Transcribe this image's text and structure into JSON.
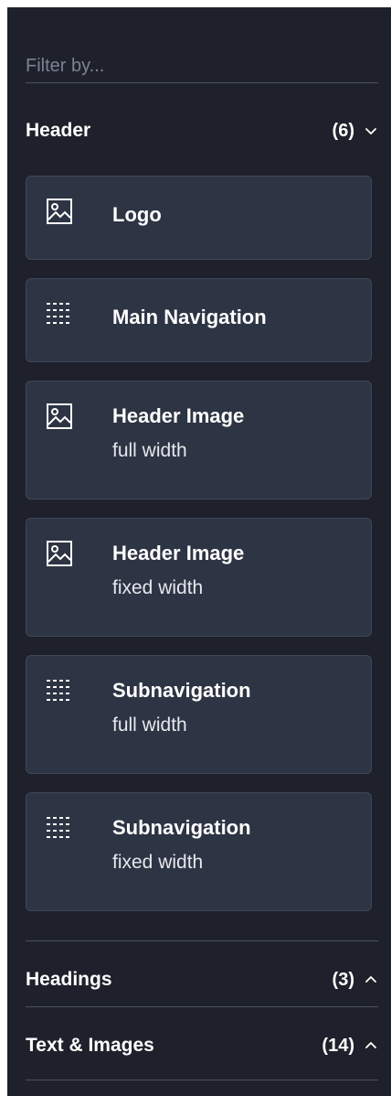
{
  "filter": {
    "placeholder": "Filter by..."
  },
  "sections": [
    {
      "title": "Header",
      "count": "(6)",
      "expanded": true,
      "items": [
        {
          "icon": "image-icon",
          "title": "Logo",
          "subtitle": ""
        },
        {
          "icon": "grid-dots-icon",
          "title": "Main Navigation",
          "subtitle": ""
        },
        {
          "icon": "image-icon",
          "title": "Header Image",
          "subtitle": "full width"
        },
        {
          "icon": "image-icon",
          "title": "Header Image",
          "subtitle": "fixed width"
        },
        {
          "icon": "grid-dots-icon",
          "title": "Subnavigation",
          "subtitle": "full width"
        },
        {
          "icon": "grid-dots-icon",
          "title": "Subnavigation",
          "subtitle": "fixed width"
        }
      ]
    },
    {
      "title": "Headings",
      "count": "(3)",
      "expanded": false
    },
    {
      "title": "Text & Images",
      "count": "(14)",
      "expanded": false
    }
  ],
  "colors": {
    "panel": "#1e212b",
    "card": "#2d3443",
    "card_border": "#3f4757",
    "divider": "#4b5160"
  }
}
